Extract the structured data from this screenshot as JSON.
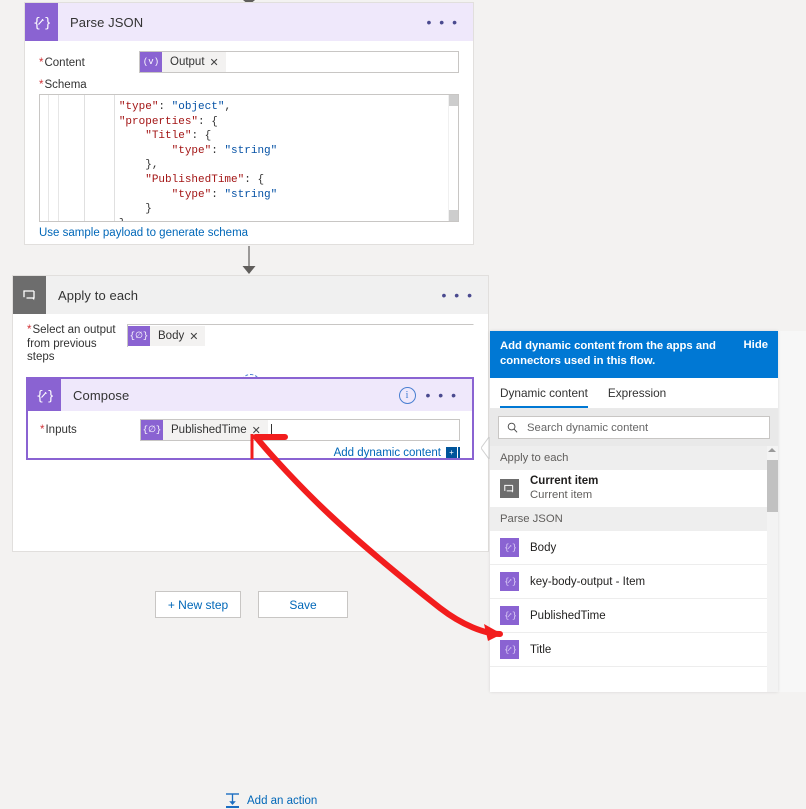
{
  "parse_json": {
    "title": "Parse JSON",
    "icon": "braces-pencil-icon",
    "menu": "• • •",
    "content_label": "Content",
    "content_token": "Output",
    "schema_label": "Schema",
    "schema_lines": [
      {
        "indent": 4,
        "segments": [
          {
            "t": "\"type\"",
            "c": "k"
          },
          {
            "t": ": ",
            "c": "p"
          },
          {
            "t": "\"object\"",
            "c": "v"
          },
          {
            "t": ",",
            "c": "p"
          }
        ]
      },
      {
        "indent": 4,
        "segments": [
          {
            "t": "\"properties\"",
            "c": "k"
          },
          {
            "t": ": {",
            "c": "p"
          }
        ]
      },
      {
        "indent": 6,
        "segments": [
          {
            "t": "\"Title\"",
            "c": "k"
          },
          {
            "t": ": {",
            "c": "p"
          }
        ]
      },
      {
        "indent": 8,
        "segments": [
          {
            "t": "\"type\"",
            "c": "k"
          },
          {
            "t": ": ",
            "c": "p"
          },
          {
            "t": "\"string\"",
            "c": "v"
          }
        ]
      },
      {
        "indent": 6,
        "segments": [
          {
            "t": "},",
            "c": "p"
          }
        ]
      },
      {
        "indent": 6,
        "segments": [
          {
            "t": "\"PublishedTime\"",
            "c": "k"
          },
          {
            "t": ": {",
            "c": "p"
          }
        ]
      },
      {
        "indent": 8,
        "segments": [
          {
            "t": "\"type\"",
            "c": "k"
          },
          {
            "t": ": ",
            "c": "p"
          },
          {
            "t": "\"string\"",
            "c": "v"
          }
        ]
      },
      {
        "indent": 6,
        "segments": [
          {
            "t": "}",
            "c": "p"
          }
        ]
      },
      {
        "indent": 4,
        "segments": [
          {
            "t": "},",
            "c": "p"
          }
        ]
      }
    ],
    "sample_payload_link": "Use sample payload to generate schema"
  },
  "apply_to_each": {
    "title": "Apply to each",
    "icon": "loop-icon",
    "menu": "• • •",
    "select_label_line1": "Select an output",
    "select_label_line2": "from previous steps",
    "select_token": "Body",
    "add_between_icon": "plus-circle-icon",
    "add_action_label": "Add an action",
    "add_action_icon": "add-action-icon"
  },
  "compose": {
    "title": "Compose",
    "icon": "braces-pencil-icon",
    "info_icon": "info-icon",
    "menu": "• • •",
    "inputs_label": "Inputs",
    "inputs_token": "PublishedTime",
    "add_dynamic_content_label": "Add dynamic content",
    "add_dynamic_content_badge": "+"
  },
  "footer": {
    "new_step_label": "+ New step",
    "save_label": "Save"
  },
  "dynamic_panel": {
    "header_text": "Add dynamic content from the apps and connectors used in this flow.",
    "hide_label": "Hide",
    "tabs": [
      {
        "label": "Dynamic content",
        "active": true
      },
      {
        "label": "Expression",
        "active": false
      }
    ],
    "search_placeholder": "Search dynamic content",
    "search_value": "",
    "search_icon": "search-icon",
    "groups": [
      {
        "name": "Apply to each",
        "items": [
          {
            "label": "Current item",
            "sub": "Current item",
            "icon": "loop-icon",
            "icon_style": "gray"
          }
        ]
      },
      {
        "name": "Parse JSON",
        "items": [
          {
            "label": "Body",
            "sub": "",
            "icon": "braces-pencil-icon",
            "icon_style": "purple"
          },
          {
            "label": "key-body-output - Item",
            "sub": "",
            "icon": "braces-pencil-icon",
            "icon_style": "purple"
          },
          {
            "label": "PublishedTime",
            "sub": "",
            "icon": "braces-pencil-icon",
            "icon_style": "purple"
          },
          {
            "label": "Title",
            "sub": "",
            "icon": "braces-pencil-icon",
            "icon_style": "purple"
          }
        ]
      }
    ]
  },
  "annotation": {
    "color": "#f21d1d",
    "description": "red-arrow-from-inputs-field-to-publishedtime-item"
  },
  "colors": {
    "accent_blue": "#0078d4",
    "link_blue": "#0067b8",
    "purple": "#8a63d2",
    "purple_light": "#efe8fb",
    "required_red": "#d13438",
    "page_bg": "#f3f2f1"
  }
}
